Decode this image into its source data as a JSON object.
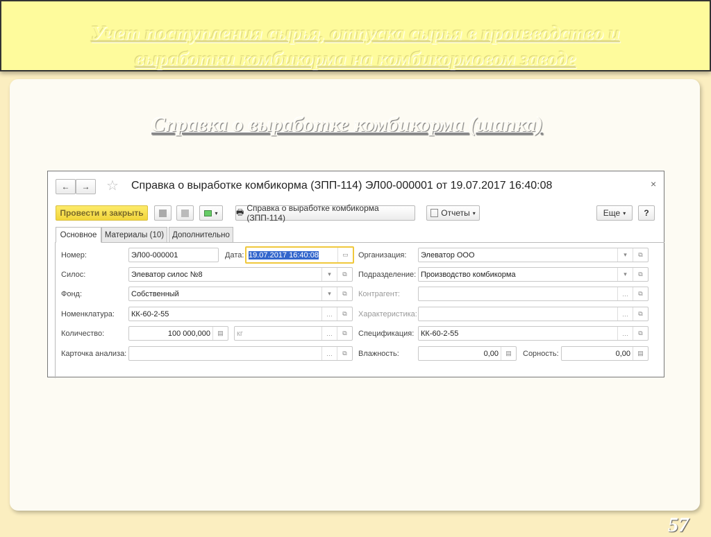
{
  "slide": {
    "title": "Учет поступления сырья, отпуска сырья в производство и выработки комбикорма на комбикормовом заводе",
    "subtitle": "Справка о выработке комбикорма (шапка)",
    "page_number": "57"
  },
  "window": {
    "title": "Справка о выработке комбикорма (ЗПП-114) ЭЛ00-000001 от 19.07.2017 16:40:08",
    "close": "×",
    "back": "←",
    "forward": "→",
    "star": "☆"
  },
  "toolbar": {
    "post_close": "Провести и закрыть",
    "print_label": "Справка о выработке комбикорма (ЗПП-114)",
    "reports": "Отчеты",
    "more": "Еще",
    "help": "?"
  },
  "tabs": [
    {
      "label": "Основное",
      "active": true
    },
    {
      "label": "Материалы (10)"
    },
    {
      "label": "Дополнительно"
    }
  ],
  "form": {
    "number": {
      "label": "Номер:",
      "value": "ЭЛ00-000001"
    },
    "date": {
      "label": "Дата:",
      "value": "19.07.2017 16:40:08"
    },
    "silo": {
      "label": "Силос:",
      "value": "Элеватор силос №8"
    },
    "fund": {
      "label": "Фонд:",
      "value": "Собственный"
    },
    "nomenclature": {
      "label": "Номенклатура:",
      "value": "КК-60-2-55"
    },
    "quantity": {
      "label": "Количество:",
      "value": "100 000,000",
      "unit": "кг"
    },
    "analysis_card": {
      "label": "Карточка анализа:",
      "value": ""
    },
    "organization": {
      "label": "Организация:",
      "value": "Элеватор ООО"
    },
    "department": {
      "label": "Подразделение:",
      "value": "Производство комбикорма"
    },
    "counterparty": {
      "label": "Контрагент:",
      "value": ""
    },
    "characteristic": {
      "label": "Характеристика:",
      "value": ""
    },
    "specification": {
      "label": "Спецификация:",
      "value": "КК-60-2-55"
    },
    "humidity": {
      "label": "Влажность:",
      "value": "0,00"
    },
    "impurity": {
      "label": "Сорность:",
      "value": "0,00"
    }
  }
}
